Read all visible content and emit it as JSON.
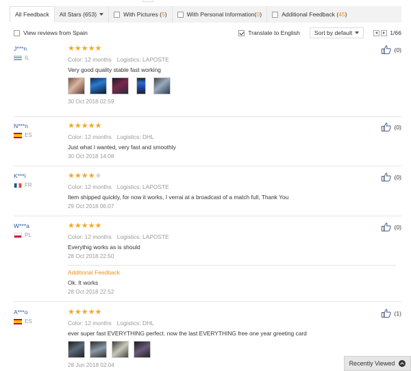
{
  "filters": {
    "all_feedback": "All Feedback",
    "all_stars": "All Stars (653)",
    "with_pictures_label": "With Pictures (",
    "with_pictures_count": "5",
    "with_pictures_close": ")",
    "personal_info_label": "With Personal Information(",
    "personal_info_count": "0",
    "personal_info_close": ")",
    "additional_label": "Additional Feedback (",
    "additional_count": "45",
    "additional_close": ")"
  },
  "toolbar": {
    "view_spain": "View reviews from Spain",
    "translate": "Translate to English",
    "sort": "Sort by default",
    "page": "1/66"
  },
  "colors": {
    "accent": "#e89020",
    "link": "#2d5c9e",
    "star": "#f5a623"
  },
  "reviews": [
    {
      "name": "J***n",
      "country": "IL",
      "stars": 5,
      "color": "Color: 12 months",
      "logistics": "Logistics: LAPOSTE",
      "text": "Very good quality stable fast working",
      "date": "30 Oct 2018 02:59",
      "helpful": "(0)"
    },
    {
      "name": "N***n",
      "country": "ES",
      "stars": 5,
      "color": "Color: 12 months",
      "logistics": "Logistics: DHL",
      "text": "Just what I wanted, very fast and smoothly",
      "date": "30 Oct 2018 14:08",
      "helpful": "(0)"
    },
    {
      "name": "K***i",
      "country": "FR",
      "stars": 4,
      "color": "Color: 12 months",
      "logistics": "Logistics: LAPOSTE",
      "text": "Item shipped quickly, for now it works, I verrai at a broadcast of a match full, Thank You",
      "date": "29 Oct 2018 06:07",
      "helpful": "(0)"
    },
    {
      "name": "W***a",
      "country": "PL",
      "stars": 5,
      "color": "Color: 12 months",
      "logistics": "Logistics: LAPOSTE",
      "text": "Everythig works as is should",
      "date": "28 Oct 2018 22:50",
      "helpful": "(0)",
      "additional_title": "Additional Feedback",
      "additional_text": "Ok. It works",
      "additional_date": "28 Oct 2018 22:52"
    },
    {
      "name": "A***o",
      "country": "ES",
      "stars": 5,
      "color": "Color: 12 months",
      "logistics": "Logistics: DHL",
      "text": "ever super fast EVERYTHING perfect. now the last EVERYTHING free one year greeting card",
      "date": "28 Jun 2018 02:04",
      "helpful": "(1)"
    }
  ],
  "recently_viewed": "Recently Viewed"
}
